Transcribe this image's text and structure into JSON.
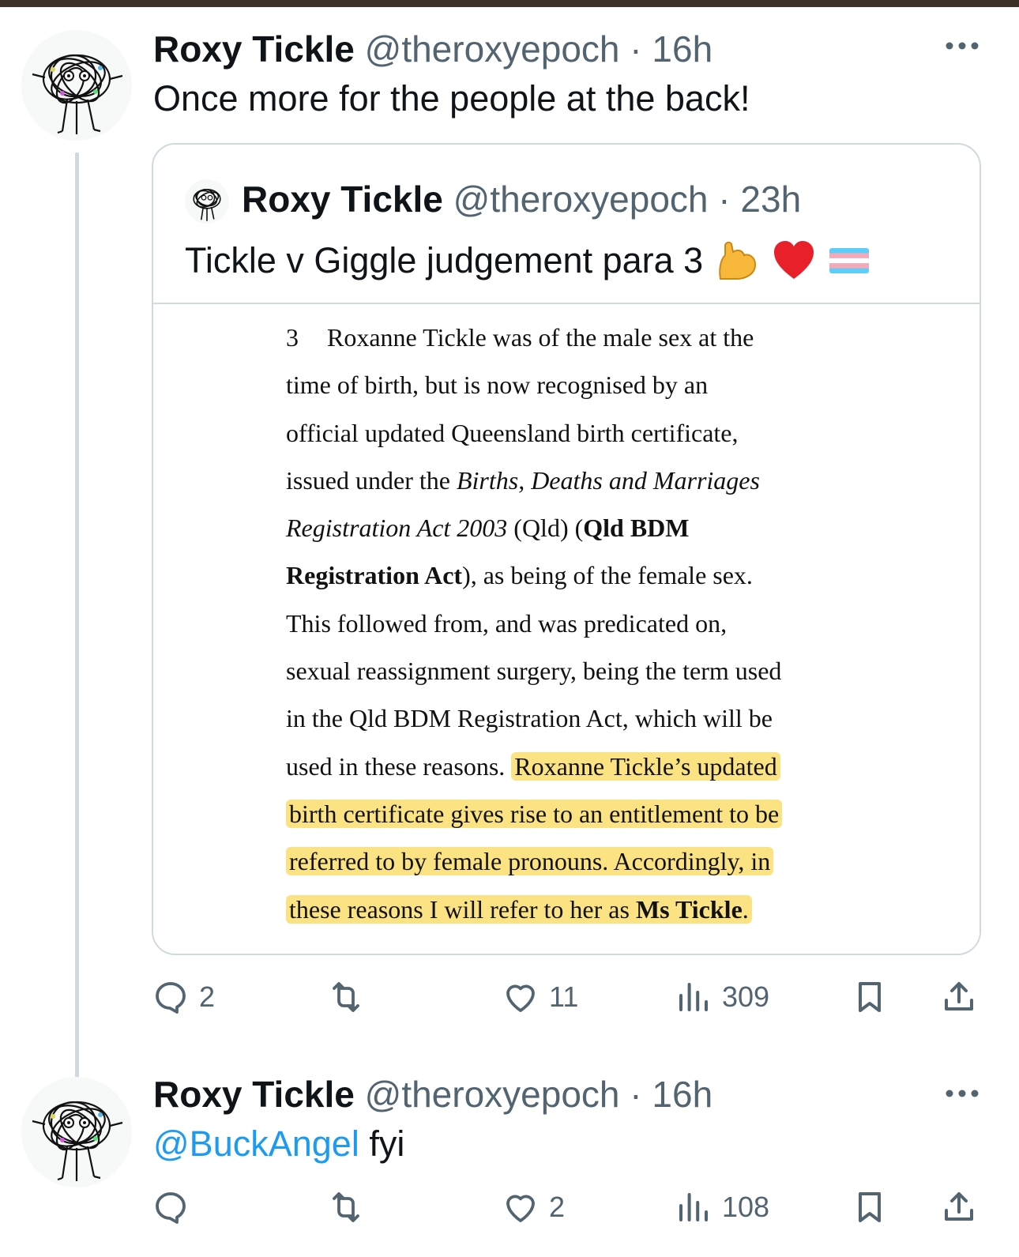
{
  "tweets": [
    {
      "name": "Roxy Tickle",
      "handle": "@theroxyepoch",
      "separator": "·",
      "time": "16h",
      "text": "Once more for the people at the back!",
      "quote": {
        "name": "Roxy Tickle",
        "handle": "@theroxyepoch",
        "separator": "·",
        "time": "23h",
        "text": "Tickle v Giggle judgement para 3",
        "emojis": [
          "flexed-biceps-emoji",
          "red-heart-emoji",
          "transgender-flag-emoji"
        ],
        "document": {
          "para_number": "3",
          "lines": [
            "Roxanne Tickle was of the male sex at the",
            "time of birth, but is now recognised by an",
            "official updated Queensland birth certificate,",
            "issued under the",
            "Births, Deaths and Marriages",
            "Registration Act 2003",
            "(Qld) (",
            "Qld BDM",
            "Registration Act",
            "), as being of the female sex.",
            "This followed from, and was predicated on,",
            "sexual reassignment surgery, being the term used",
            "in the Qld BDM Registration Act, which will be",
            "used in these reasons.",
            "Roxanne Tickle’s updated",
            "birth certificate gives rise to an entitlement to be",
            "referred to by female pronouns. Accordingly, in",
            "these reasons I will refer to her as",
            "Ms Tickle",
            "."
          ],
          "highlight_color": "#fade6e"
        }
      },
      "actions": {
        "replies": "2",
        "retweets": "",
        "likes": "11",
        "views": "309"
      }
    },
    {
      "name": "Roxy Tickle",
      "handle": "@theroxyepoch",
      "separator": "·",
      "time": "16h",
      "mention": "@BuckAngel",
      "text": "fyi",
      "actions": {
        "replies": "",
        "retweets": "",
        "likes": "2",
        "views": "108"
      }
    }
  ],
  "colors": {
    "text": "#0f1419",
    "secondary": "#536471",
    "link": "#1d9bf0",
    "border": "#cfd9de"
  }
}
